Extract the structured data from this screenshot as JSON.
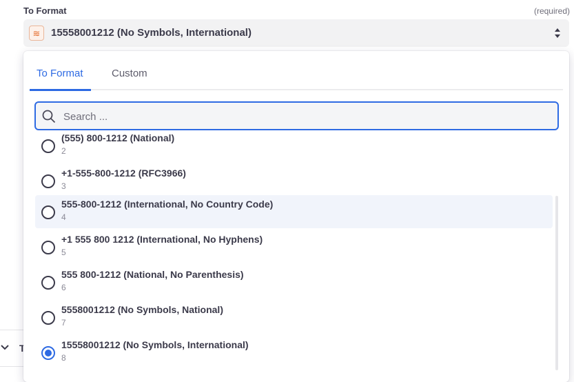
{
  "field": {
    "label": "To Format",
    "required": "(required)",
    "selected_value": "15558001212 (No Symbols, International)",
    "app_icon": "formatter-icon"
  },
  "background": {
    "section_letter": "T"
  },
  "dropdown": {
    "tabs": [
      {
        "label": "To Format",
        "active": true
      },
      {
        "label": "Custom",
        "active": false
      }
    ],
    "search": {
      "placeholder": "Search ...",
      "value": ""
    },
    "options": [
      {
        "label": "(555) 800-1212 (National)",
        "sub": "2",
        "checked": false,
        "hover": false
      },
      {
        "label": "+1-555-800-1212 (RFC3966)",
        "sub": "3",
        "checked": false,
        "hover": false
      },
      {
        "label": "555-800-1212 (International, No Country Code)",
        "sub": "4",
        "checked": false,
        "hover": true
      },
      {
        "label": "+1 555 800 1212 (International, No Hyphens)",
        "sub": "5",
        "checked": false,
        "hover": false
      },
      {
        "label": "555 800-1212 (National, No Parenthesis)",
        "sub": "6",
        "checked": false,
        "hover": false
      },
      {
        "label": "5558001212 (No Symbols, National)",
        "sub": "7",
        "checked": false,
        "hover": false
      },
      {
        "label": "15558001212 (No Symbols, International)",
        "sub": "8",
        "checked": true,
        "hover": false
      }
    ]
  },
  "colors": {
    "accent": "#2d6ae3",
    "text": "#3b3a4a",
    "muted": "#8a8996",
    "icon": "#e46a2a"
  }
}
